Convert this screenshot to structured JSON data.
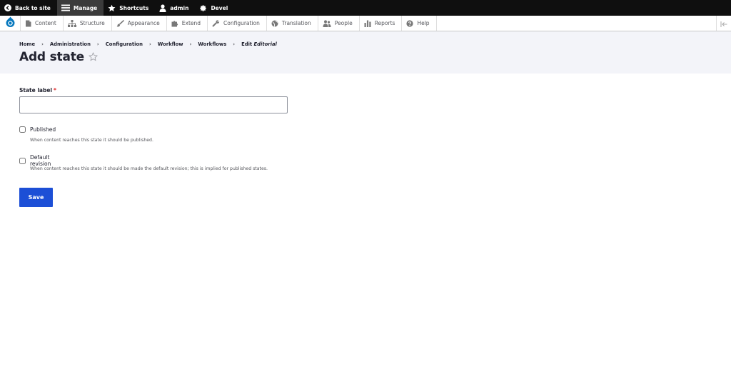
{
  "toolbar": {
    "items": [
      {
        "label": "Back to site",
        "icon": "back-circle-icon"
      },
      {
        "label": "Manage",
        "icon": "hamburger-menu-icon"
      },
      {
        "label": "Shortcuts",
        "icon": "star-icon"
      },
      {
        "label": "admin",
        "icon": "user-icon"
      },
      {
        "label": "Devel",
        "icon": "gear-icon"
      }
    ]
  },
  "tray": {
    "items": [
      {
        "label": "Content",
        "icon": "document-icon"
      },
      {
        "label": "Structure",
        "icon": "structure-icon"
      },
      {
        "label": "Appearance",
        "icon": "paintbrush-icon"
      },
      {
        "label": "Extend",
        "icon": "puzzle-icon"
      },
      {
        "label": "Configuration",
        "icon": "wrench-icon"
      },
      {
        "label": "Translation",
        "icon": "globe-icon"
      },
      {
        "label": "People",
        "icon": "people-icon"
      },
      {
        "label": "Reports",
        "icon": "bar-chart-icon"
      },
      {
        "label": "Help",
        "icon": "help-circle-icon"
      }
    ]
  },
  "breadcrumb": {
    "items": [
      "Home",
      "Administration",
      "Configuration",
      "Workflow",
      "Workflows"
    ],
    "current_prefix": "Edit",
    "current_emph": "Editorial",
    "separator": "›"
  },
  "page": {
    "title": "Add state",
    "star_glyph": "☆"
  },
  "form": {
    "state_label": "State label",
    "required_mark": "*",
    "state_value": "",
    "published_label": "Published",
    "published_desc": "When content reaches this state it should be published.",
    "published_checked": false,
    "default_label": "Default revision",
    "default_desc": "When content reaches this state it should be made the default revision; this is implied for published states.",
    "default_checked": false,
    "save_label": "Save"
  },
  "colors": {
    "toolbar_bg": "#0f0f0f",
    "header_bg": "#f3f4f9",
    "primary_button": "#1c4fd6",
    "required": "#dc2323"
  }
}
